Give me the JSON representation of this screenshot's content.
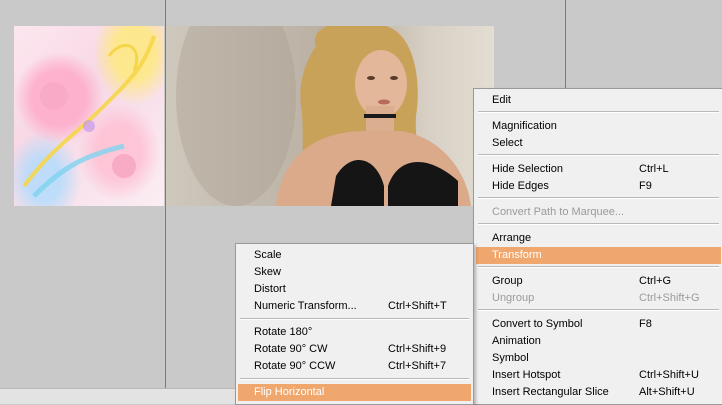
{
  "main_menu": {
    "items": [
      {
        "label": "Edit"
      },
      {
        "label": "Magnification"
      },
      {
        "label": "Select"
      },
      {
        "label": "Hide Selection",
        "shortcut": "Ctrl+L"
      },
      {
        "label": "Hide Edges",
        "shortcut": "F9"
      },
      {
        "label": "Convert Path to Marquee...",
        "disabled": true
      },
      {
        "label": "Arrange"
      },
      {
        "label": "Transform",
        "highlighted": true
      },
      {
        "label": "Group",
        "shortcut": "Ctrl+G"
      },
      {
        "label": "Ungroup",
        "shortcut": "Ctrl+Shift+G",
        "disabled": true
      },
      {
        "label": "Convert to Symbol",
        "shortcut": "F8"
      },
      {
        "label": "Animation"
      },
      {
        "label": "Symbol"
      },
      {
        "label": "Insert Hotspot",
        "shortcut": "Ctrl+Shift+U"
      },
      {
        "label": "Insert Rectangular Slice",
        "shortcut": "Alt+Shift+U"
      }
    ]
  },
  "transform_submenu": {
    "items": [
      {
        "label": "Scale"
      },
      {
        "label": "Skew"
      },
      {
        "label": "Distort"
      },
      {
        "label": "Numeric Transform...",
        "shortcut": "Ctrl+Shift+T"
      },
      {
        "label": "Rotate 180°"
      },
      {
        "label": "Rotate 90° CW",
        "shortcut": "Ctrl+Shift+9"
      },
      {
        "label": "Rotate 90° CCW",
        "shortcut": "Ctrl+Shift+7"
      },
      {
        "label": "Flip Horizontal",
        "highlighted": true
      }
    ]
  },
  "colors": {
    "highlight": "#f0a76e",
    "guide": "#1e90ff",
    "canvas": "#c9c9c9"
  }
}
